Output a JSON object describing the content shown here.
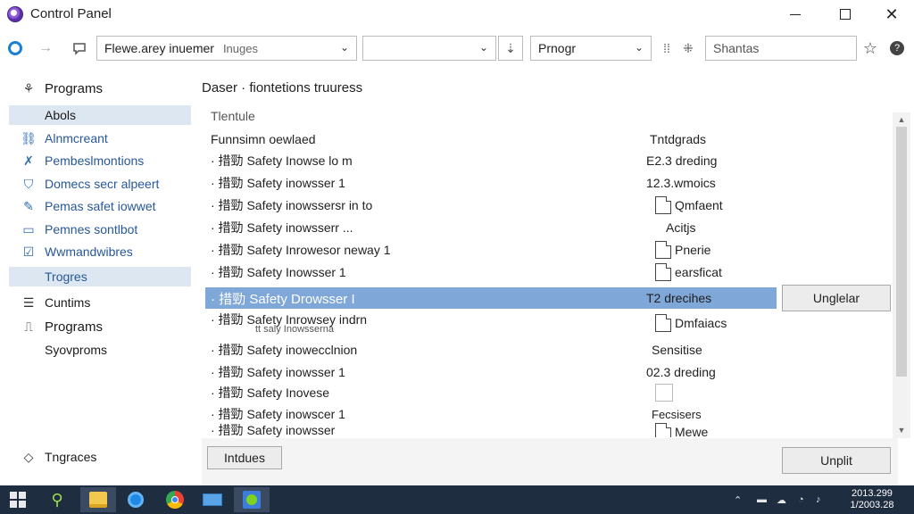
{
  "window": {
    "title": "Control Panel",
    "minimize": "–",
    "close": "✕"
  },
  "toolbar": {
    "address_main": "Flewe.arey inuemer",
    "address_sub": "Inuges",
    "combo2_value": "",
    "combo3_value": "Prnogr",
    "search_placeholder": "Shantas"
  },
  "nav": {
    "items": [
      {
        "label": "Programs"
      },
      {
        "label": "Abols"
      },
      {
        "label": "Alnmcreant"
      },
      {
        "label": "Pembeslmontions"
      },
      {
        "label": "Domecs secr alpeert"
      },
      {
        "label": "Pemas safet iowwet"
      },
      {
        "label": "Pemnes sontlbot"
      },
      {
        "label": "Wwmandwibres"
      },
      {
        "label": "Trogres"
      },
      {
        "label": "Cuntims"
      },
      {
        "label": "Programs"
      },
      {
        "label": "Syovproms"
      },
      {
        "label": "Tngraces"
      }
    ]
  },
  "main": {
    "heading": "Daser · fiontetions truuress",
    "column_header": "Tlentule",
    "list_title": "Funnsimn oewlaed",
    "list_title_info": "Tntdgrads",
    "rows": [
      {
        "name": "· 措勁 Safety Inowse lo m",
        "info": "E2.3 dreding"
      },
      {
        "name": "· 措勁 Safety inowsser 1",
        "info": "12.3.wmoics"
      },
      {
        "name": "· 措勁 Safety inowssersr in to",
        "info": "Qmfaent"
      },
      {
        "name": "· 措勁 Safety inowsserr ...",
        "info": "Acitjs"
      },
      {
        "name": "· 措勁 Safety Inrowesor neway 1",
        "info": "Pnerie"
      },
      {
        "name": "· 措勁 Safety Inowsser 1",
        "info": "earsficat"
      },
      {
        "name": "· 措勁 Safety Drowsser I",
        "info": "T2 drecihes"
      },
      {
        "name": "· 措勁 Safety Inrowsey indrn",
        "sub": "tt saly Inowsserna",
        "info": "Dmfaiacs"
      },
      {
        "name": "· 措勁 Safety inowecclnion",
        "info": "Sensitise"
      },
      {
        "name": "· 措勁 Safety inowsser 1",
        "info": "02.3 dreding"
      },
      {
        "name": "· 措勁 Safety Inovese",
        "info": ""
      },
      {
        "name": "· 措勁 Safety inowscer 1",
        "info": "Fecsisers"
      },
      {
        "name": "· 措勁 Safety inowsser",
        "info": "Mewe"
      }
    ],
    "side_button": "Unglelar",
    "footer_left_button": "Intdues",
    "footer_right_button": "Unplit"
  },
  "taskbar": {
    "clock_time": "2013.299",
    "clock_date": "1/2003.28"
  }
}
